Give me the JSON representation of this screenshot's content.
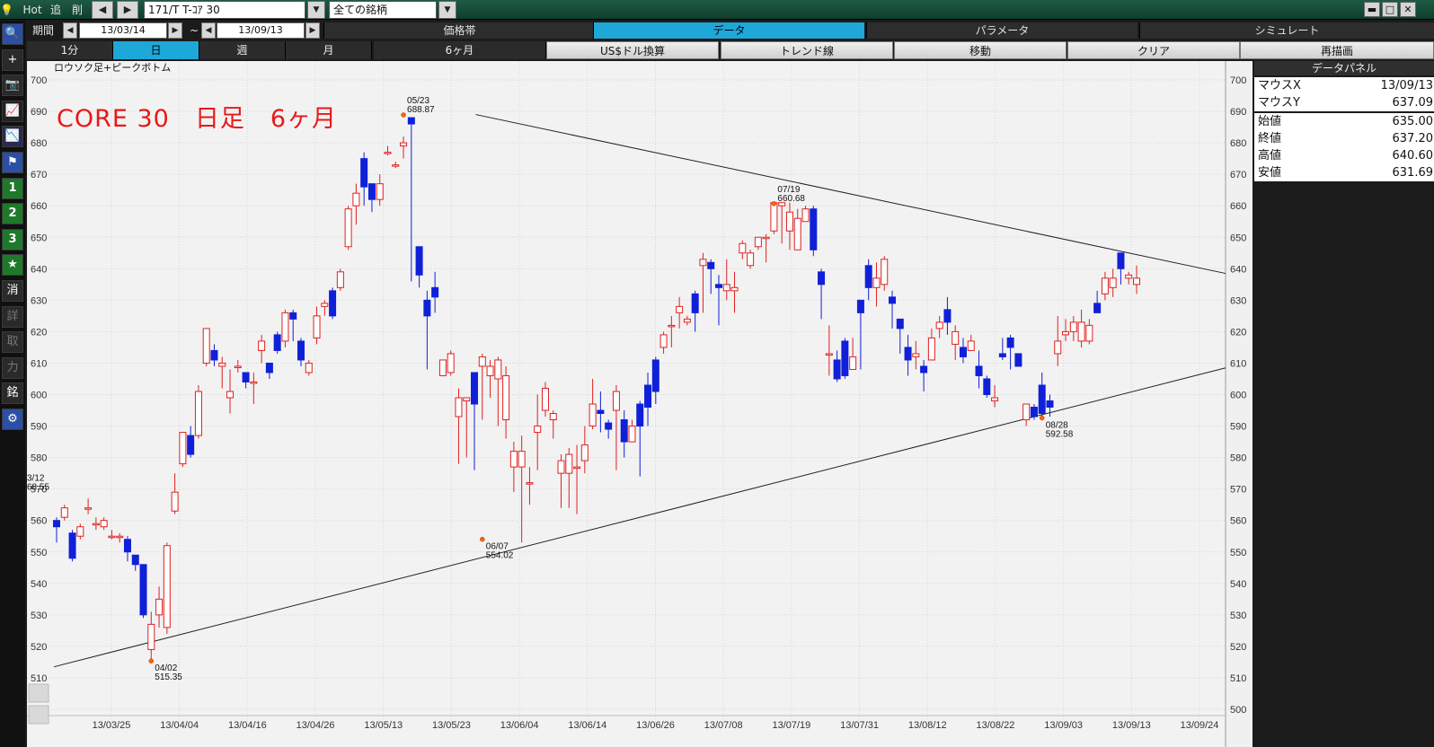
{
  "titlebar": {
    "hot_label": "Hot",
    "add_label": "追",
    "del_label": "削",
    "prev_arrow": "◀",
    "next_arrow": "▶",
    "symbol": "171/T T-ｺｱ 30",
    "dropdown_arrow": "▼",
    "universe": "全ての銘柄",
    "minimize": "▬",
    "maximize": "□",
    "close": "✕"
  },
  "period": {
    "label": "期間",
    "from": "13/03/14",
    "tilde": "~",
    "to": "13/09/13",
    "left_arrow": "◀",
    "right_arrow": "▶"
  },
  "top_tabs": [
    {
      "label": "価格帯",
      "active": false
    },
    {
      "label": "データ",
      "active": true
    },
    {
      "label": "パラメータ",
      "active": false
    },
    {
      "label": "シミュレート",
      "active": false
    }
  ],
  "interval_tabs": [
    {
      "label": "1分",
      "active": false
    },
    {
      "label": "日",
      "active": true
    },
    {
      "label": "週",
      "active": false
    },
    {
      "label": "月",
      "active": false
    },
    {
      "label": "6ヶ月",
      "active": false
    }
  ],
  "tool_buttons": [
    {
      "label": "US$ドル換算"
    },
    {
      "label": "トレンド線"
    },
    {
      "label": "移動"
    },
    {
      "label": "クリア"
    },
    {
      "label": "再描画"
    }
  ],
  "left_tools": [
    {
      "name": "search-icon",
      "glyph": "🔍"
    },
    {
      "name": "crosshair-icon",
      "glyph": "+"
    },
    {
      "name": "camera-icon",
      "glyph": "📷"
    },
    {
      "name": "chart-line-icon",
      "glyph": "📈"
    },
    {
      "name": "chart-compare-icon",
      "glyph": "📉"
    },
    {
      "name": "flag-icon",
      "glyph": "⚑"
    },
    {
      "name": "layout-1-button",
      "glyph": "1"
    },
    {
      "name": "layout-2-button",
      "glyph": "2"
    },
    {
      "name": "layout-3-button",
      "glyph": "3"
    },
    {
      "name": "favorite-icon",
      "glyph": "★"
    },
    {
      "name": "erase-button",
      "glyph": "消"
    },
    {
      "name": "detail-button",
      "glyph": "詳"
    },
    {
      "name": "trade-button",
      "glyph": "取"
    },
    {
      "name": "power-button",
      "glyph": "力"
    },
    {
      "name": "stock-name-button",
      "glyph": "銘"
    },
    {
      "name": "settings-gear-icon",
      "glyph": "⚙"
    }
  ],
  "chart": {
    "label": "ロウソク足+ピークボトム",
    "title": "CORE 30　日足　6ヶ月"
  },
  "data_panel": {
    "title": "データパネル",
    "mouse": [
      {
        "label": "マウスX",
        "value": "13/09/13"
      },
      {
        "label": "マウスY",
        "value": "637.09"
      }
    ],
    "ohlc": [
      {
        "label": "始値",
        "value": "635.00"
      },
      {
        "label": "終値",
        "value": "637.20"
      },
      {
        "label": "高値",
        "value": "640.60"
      },
      {
        "label": "安値",
        "value": "631.69"
      }
    ]
  },
  "chart_data": {
    "type": "candlestick",
    "ylim": [
      500,
      700
    ],
    "y_ticks": [
      "700",
      "690",
      "680",
      "670",
      "660",
      "650",
      "640",
      "630",
      "620",
      "610",
      "600",
      "590",
      "580",
      "570",
      "560",
      "550",
      "540",
      "530",
      "520",
      "510",
      "500"
    ],
    "x_ticks": [
      "13/03/25",
      "13/04/04",
      "13/04/16",
      "13/04/26",
      "13/05/13",
      "13/05/23",
      "13/06/04",
      "13/06/14",
      "13/06/26",
      "13/07/08",
      "13/07/19",
      "13/07/31",
      "13/08/12",
      "13/08/22",
      "13/09/03",
      "13/09/13",
      "13/09/24"
    ],
    "candles": [
      [
        560,
        558,
        561,
        553
      ],
      [
        561,
        564,
        565,
        560
      ],
      [
        556,
        548,
        557,
        547
      ],
      [
        555,
        558,
        559,
        554
      ],
      [
        564,
        564,
        567,
        562
      ],
      [
        559,
        559,
        561,
        557
      ],
      [
        558,
        560,
        561,
        557
      ],
      [
        555,
        555,
        557,
        554
      ],
      [
        555,
        555,
        556,
        553
      ],
      [
        554,
        550,
        555,
        547
      ],
      [
        549,
        546,
        549,
        544
      ],
      [
        546,
        530,
        546,
        529
      ],
      [
        519,
        527,
        531,
        515
      ],
      [
        530,
        535,
        539,
        526
      ],
      [
        526,
        552,
        553,
        524
      ],
      [
        563,
        569,
        575,
        562
      ],
      [
        578,
        588,
        588,
        577
      ],
      [
        587,
        581,
        590,
        580
      ],
      [
        587,
        601,
        603,
        586
      ],
      [
        610,
        621,
        621,
        609
      ],
      [
        614,
        611,
        616,
        609
      ],
      [
        609,
        610,
        612,
        602
      ],
      [
        599,
        601,
        608,
        594
      ],
      [
        609,
        609,
        611,
        607
      ],
      [
        607,
        604,
        607,
        602
      ],
      [
        604,
        604,
        607,
        597
      ],
      [
        614,
        617,
        619,
        610
      ],
      [
        610,
        607,
        610,
        605
      ],
      [
        619,
        614,
        620,
        613
      ],
      [
        617,
        626,
        627,
        615
      ],
      [
        626,
        624,
        627,
        617
      ],
      [
        617,
        611,
        618,
        609
      ],
      [
        607,
        610,
        611,
        606
      ],
      [
        618,
        625,
        628,
        616
      ],
      [
        628,
        629,
        630,
        625
      ],
      [
        633,
        625,
        634,
        624
      ],
      [
        634,
        639,
        640,
        633
      ],
      [
        647,
        659,
        660,
        646
      ],
      [
        660,
        664,
        667,
        654
      ],
      [
        675,
        666,
        677,
        660
      ],
      [
        667,
        662,
        667,
        658
      ],
      [
        662,
        667,
        670,
        660
      ],
      [
        677,
        677,
        679,
        676
      ],
      [
        673,
        673,
        674,
        672
      ],
      [
        679,
        680,
        682,
        675
      ],
      [
        688,
        686,
        687,
        636
      ],
      [
        647,
        638,
        647,
        634
      ],
      [
        630,
        625,
        633,
        608
      ],
      [
        634,
        631,
        639,
        626
      ],
      [
        606,
        611,
        611,
        606
      ],
      [
        607,
        613,
        614,
        606
      ],
      [
        593,
        599,
        602,
        578
      ],
      [
        598,
        599,
        599,
        580
      ],
      [
        607,
        597,
        607,
        576
      ],
      [
        609,
        612,
        613,
        592
      ],
      [
        606,
        609,
        611,
        599
      ],
      [
        605,
        611,
        612,
        590
      ],
      [
        592,
        606,
        609,
        586
      ],
      [
        577,
        582,
        585,
        569
      ],
      [
        577,
        582,
        587,
        553
      ],
      [
        572,
        572,
        577,
        565
      ],
      [
        588,
        590,
        600,
        576
      ],
      [
        595,
        602,
        604,
        593
      ],
      [
        592,
        594,
        595,
        586
      ],
      [
        575,
        579,
        581,
        564
      ],
      [
        575,
        581,
        583,
        564
      ],
      [
        577,
        577,
        584,
        562
      ],
      [
        579,
        584,
        590,
        575
      ],
      [
        590,
        597,
        605,
        589
      ],
      [
        595,
        594,
        601,
        588
      ],
      [
        591,
        589,
        592,
        586
      ],
      [
        595,
        601,
        603,
        576
      ],
      [
        592,
        585,
        595,
        580
      ],
      [
        585,
        590,
        592,
        585
      ],
      [
        597,
        590,
        598,
        574
      ],
      [
        603,
        596,
        607,
        590
      ],
      [
        611,
        601,
        612,
        597
      ],
      [
        615,
        619,
        620,
        613
      ],
      [
        622,
        622,
        625,
        615
      ],
      [
        626,
        628,
        631,
        621
      ],
      [
        623,
        624,
        625,
        622
      ],
      [
        632,
        626,
        633,
        620
      ],
      [
        641,
        643,
        645,
        626
      ],
      [
        642,
        640,
        643,
        632
      ],
      [
        635,
        634,
        638,
        622
      ],
      [
        633,
        635,
        643,
        630
      ],
      [
        633,
        634,
        639,
        626
      ],
      [
        645,
        648,
        649,
        643
      ],
      [
        641,
        645,
        646,
        640
      ],
      [
        647,
        650,
        650,
        646
      ],
      [
        650,
        650,
        651,
        642
      ],
      [
        652,
        661,
        661,
        651
      ],
      [
        660,
        661,
        661,
        648
      ],
      [
        652,
        658,
        661,
        646
      ],
      [
        646,
        656,
        659,
        653
      ],
      [
        655,
        659,
        660,
        655
      ],
      [
        659,
        646,
        660,
        644
      ],
      [
        639,
        635,
        640,
        624
      ],
      [
        613,
        613,
        622,
        606
      ],
      [
        611,
        605,
        614,
        604
      ],
      [
        617,
        606,
        618,
        605
      ],
      [
        608,
        612,
        618,
        608
      ],
      [
        630,
        626,
        630,
        608
      ],
      [
        641,
        634,
        643,
        630
      ],
      [
        634,
        637,
        642,
        628
      ],
      [
        635,
        643,
        644,
        633
      ],
      [
        631,
        629,
        633,
        621
      ],
      [
        624,
        621,
        624,
        613
      ],
      [
        615,
        611,
        619,
        606
      ],
      [
        612,
        613,
        617,
        608
      ],
      [
        609,
        607,
        611,
        601
      ],
      [
        611,
        618,
        621,
        611
      ],
      [
        621,
        623,
        625,
        618
      ],
      [
        627,
        623,
        631,
        619
      ],
      [
        616,
        620,
        622,
        611
      ],
      [
        615,
        612,
        618,
        610
      ],
      [
        614,
        617,
        619,
        614
      ],
      [
        609,
        606,
        614,
        602
      ],
      [
        605,
        600,
        606,
        599
      ],
      [
        598,
        599,
        603,
        596
      ],
      [
        613,
        612,
        618,
        611
      ],
      [
        618,
        615,
        619,
        608
      ],
      [
        613,
        609,
        613,
        609
      ],
      [
        592,
        597,
        597,
        590
      ],
      [
        596,
        593,
        597,
        592
      ],
      [
        603,
        594,
        607,
        593
      ],
      [
        598,
        596,
        600,
        593
      ],
      [
        613,
        617,
        625,
        609
      ],
      [
        619,
        620,
        624,
        617
      ],
      [
        620,
        623,
        625,
        617
      ],
      [
        617,
        623,
        627,
        615
      ],
      [
        617,
        622,
        624,
        616
      ],
      [
        629,
        626,
        633,
        626
      ],
      [
        632,
        637,
        639,
        630
      ],
      [
        634,
        637,
        640,
        631
      ],
      [
        645,
        640,
        645,
        635
      ],
      [
        637,
        638,
        639,
        635
      ],
      [
        635,
        637,
        641,
        632
      ]
    ],
    "trendlines": [
      {
        "x1": 0.0,
        "y1": 513.5,
        "x2": 1.0,
        "y2": 608.5
      },
      {
        "x1": 0.36,
        "y1": 689,
        "x2": 1.0,
        "y2": 638.5
      }
    ],
    "peak_labels": [
      {
        "date": "04/02",
        "value": "515.35",
        "candle": 12,
        "price": 515.35,
        "pos": "below"
      },
      {
        "date": "05/23",
        "value": "688.87",
        "candle": 44,
        "price": 688.87,
        "pos": "above"
      },
      {
        "date": "06/07",
        "value": "554.02",
        "candle": 54,
        "price": 554.02,
        "pos": "below"
      },
      {
        "date": "07/19",
        "value": "660.68",
        "candle": 91,
        "price": 660.68,
        "pos": "above"
      },
      {
        "date": "08/28",
        "value": "592.58",
        "candle": 125,
        "price": 592.58,
        "pos": "below"
      },
      {
        "date": "3/12",
        "value": "68.55",
        "candle": -1,
        "price": 570,
        "pos": "edge"
      }
    ]
  }
}
